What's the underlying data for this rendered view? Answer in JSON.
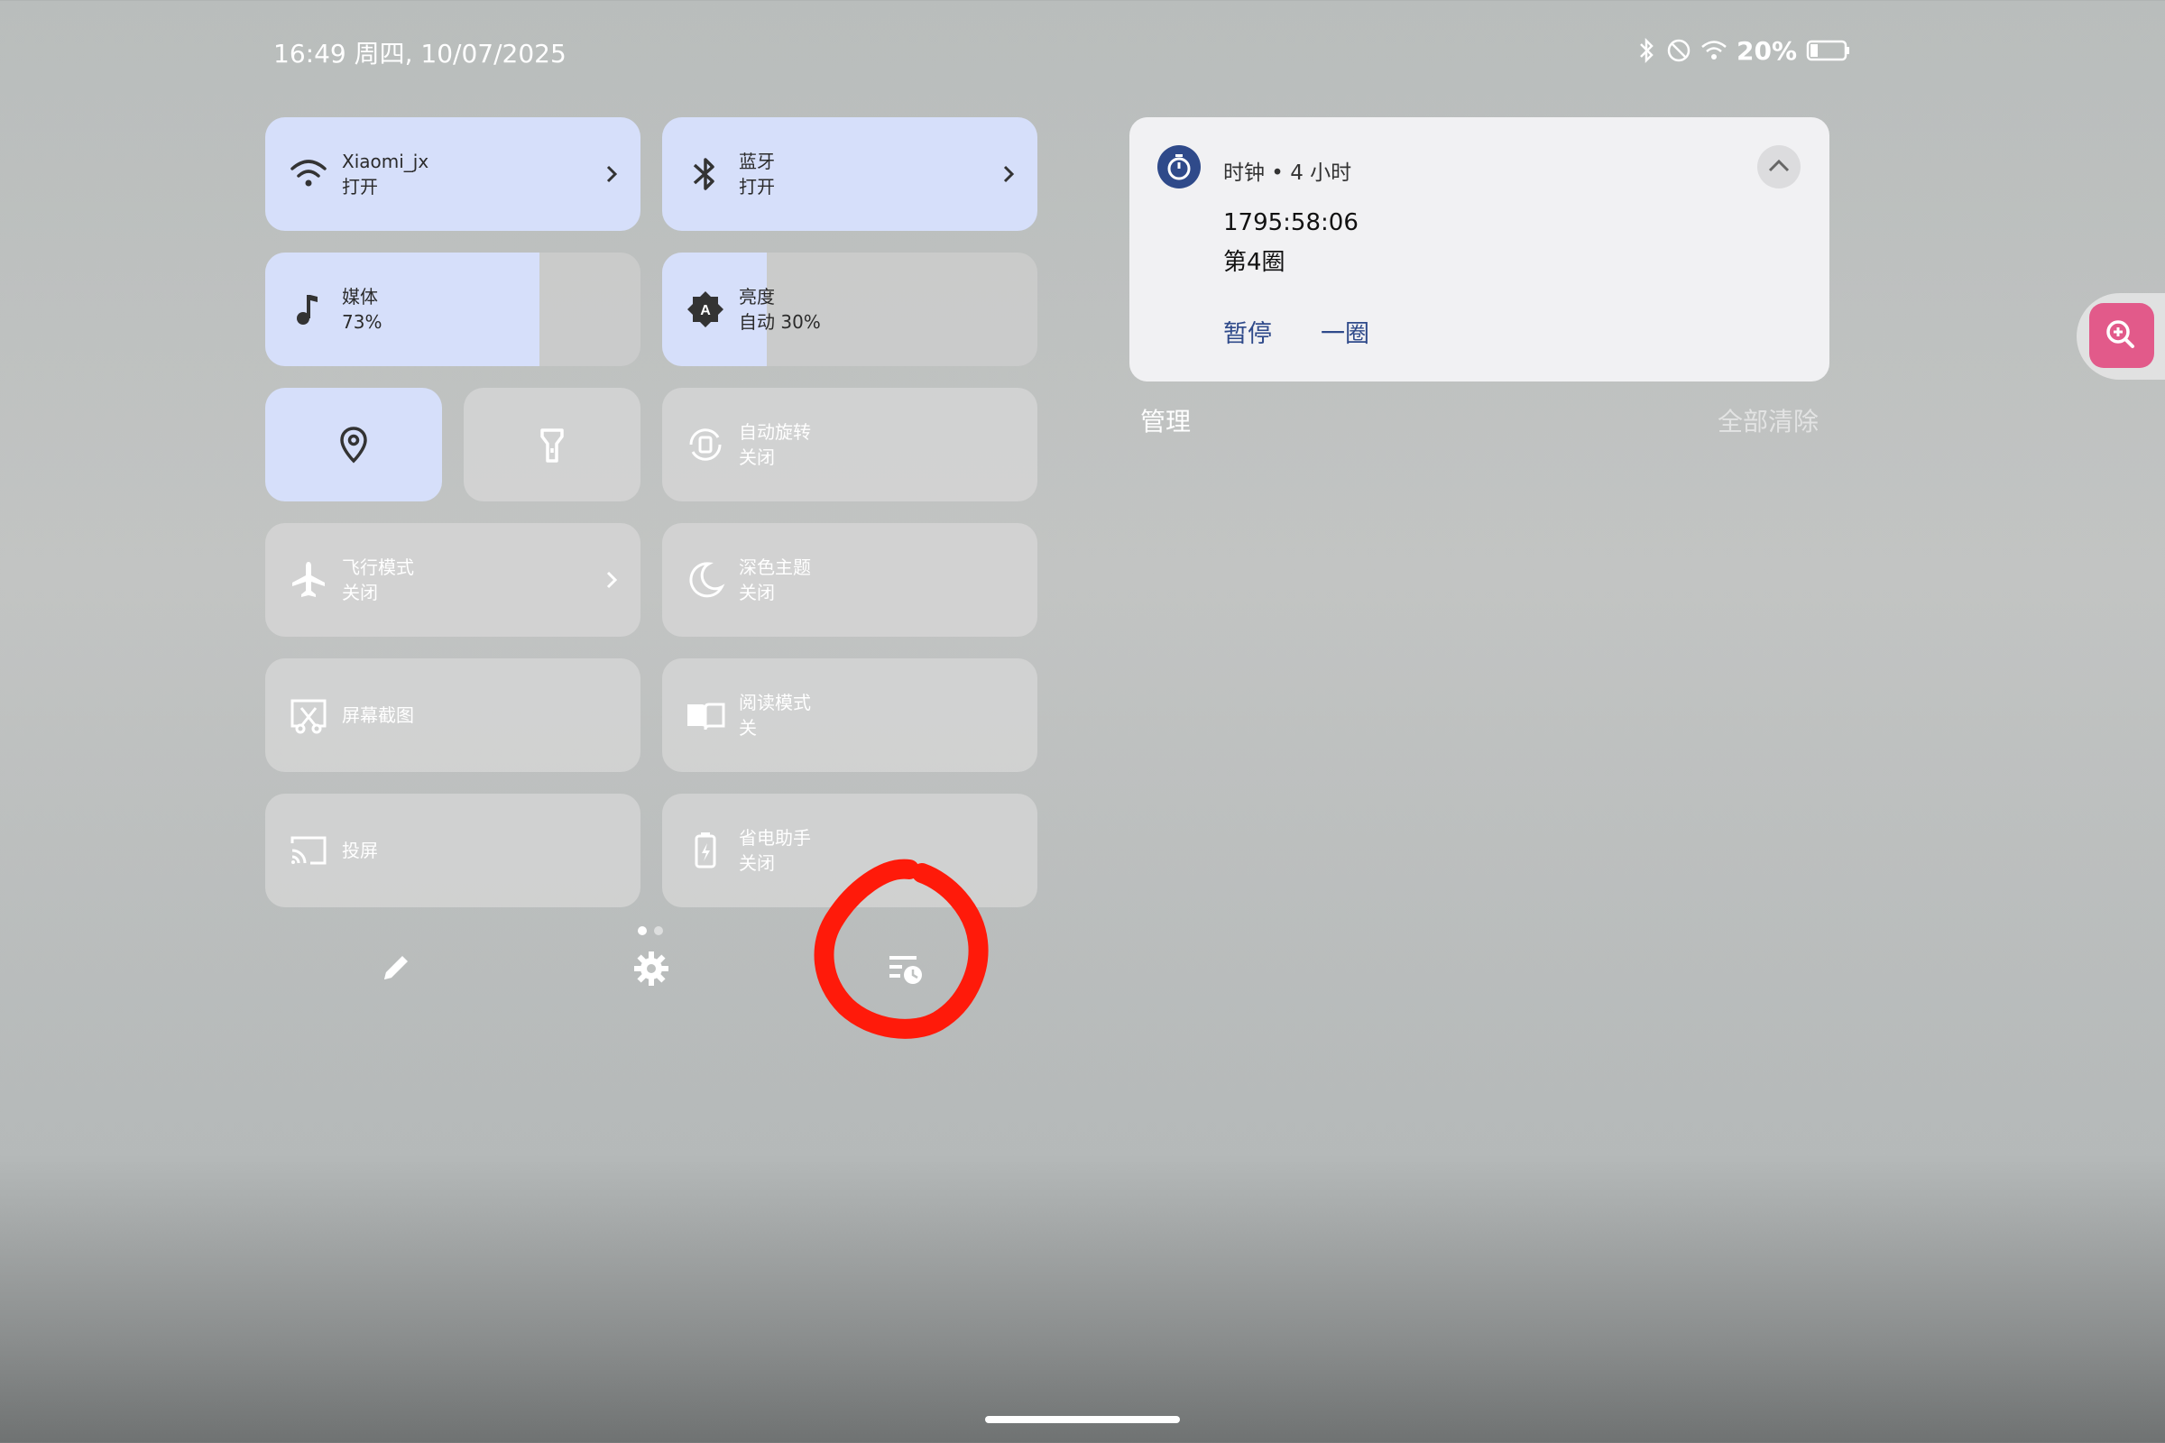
{
  "status_bar": {
    "time_date": "16:49 周四, 10/07/2025",
    "battery": "20%"
  },
  "tiles": {
    "wifi": {
      "title": "Xiaomi_jx",
      "subtitle": "打开"
    },
    "bluetooth": {
      "title": "蓝牙",
      "subtitle": "打开"
    },
    "media": {
      "title": "媒体",
      "subtitle": "73%",
      "level": 0.73
    },
    "brightness": {
      "title": "亮度",
      "subtitle": "自动 30%",
      "level": 0.28
    },
    "auto_rotate": {
      "title": "自动旋转",
      "subtitle": "关闭"
    },
    "airplane": {
      "title": "飞行模式",
      "subtitle": "关闭"
    },
    "dark_theme": {
      "title": "深色主题",
      "subtitle": "关闭"
    },
    "screenshot": {
      "title": "屏幕截图"
    },
    "reading_mode": {
      "title": "阅读模式",
      "subtitle": "关"
    },
    "cast": {
      "title": "投屏"
    },
    "battery_saver": {
      "title": "省电助手",
      "subtitle": "关闭"
    }
  },
  "notification": {
    "app_line": "时钟 • 4 小时",
    "elapsed": "1795:58:06",
    "lap": "第4圈",
    "pause_button": "暂停",
    "lap_button": "一圈"
  },
  "manage_label": "管理",
  "clear_all_label": "全部清除",
  "colors": {
    "tile_on": "#d6dffa",
    "annotation": "#ff1a0a",
    "zoom_button": "#e25a8a",
    "clock_icon": "#2f4a8a"
  }
}
